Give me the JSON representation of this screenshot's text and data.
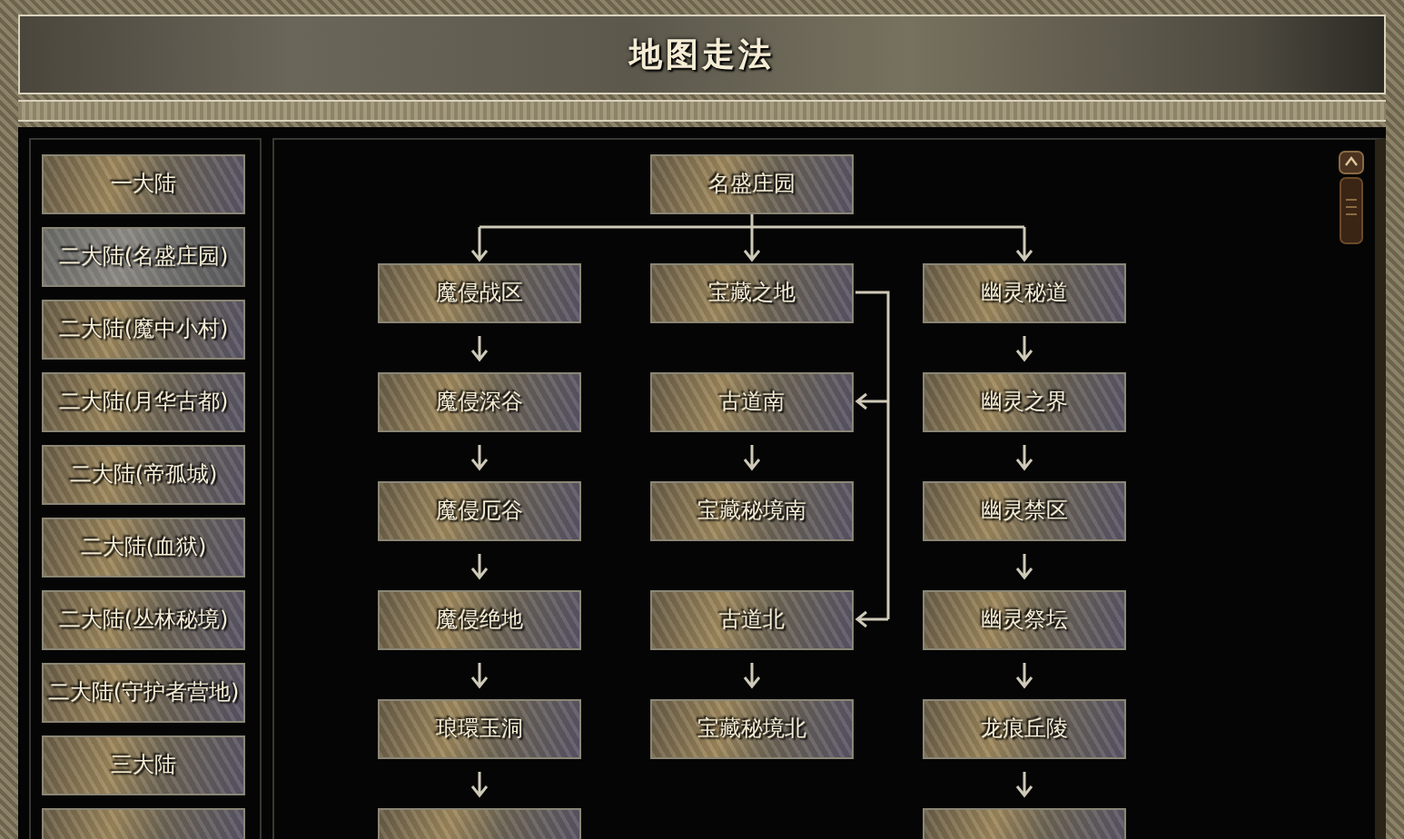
{
  "window": {
    "title": "地图走法"
  },
  "sidebar": {
    "more_below": true,
    "items": [
      {
        "label": "一大陆",
        "selected": false
      },
      {
        "label": "二大陆(名盛庄园)",
        "selected": true
      },
      {
        "label": "二大陆(魔中小村)",
        "selected": false
      },
      {
        "label": "二大陆(月华古都)",
        "selected": false
      },
      {
        "label": "二大陆(帝孤城)",
        "selected": false
      },
      {
        "label": "二大陆(血狱)",
        "selected": false
      },
      {
        "label": "二大陆(丛林秘境)",
        "selected": false
      },
      {
        "label": "二大陆(守护者营地)",
        "selected": false
      },
      {
        "label": "三大陆",
        "selected": false
      }
    ]
  },
  "diagram": {
    "root": "名盛庄园",
    "columns": [
      {
        "continues": true,
        "nodes": [
          {
            "label": "魔侵战区",
            "from_side": false
          },
          {
            "label": "魔侵深谷",
            "from_side": false
          },
          {
            "label": "魔侵厄谷",
            "from_side": false
          },
          {
            "label": "魔侵绝地",
            "from_side": false
          },
          {
            "label": "琅環玉洞",
            "from_side": false
          }
        ]
      },
      {
        "nodes": [
          {
            "label": "宝藏之地",
            "from_side": false
          },
          {
            "label": "古道南",
            "from_side": true
          },
          {
            "label": "宝藏秘境南",
            "from_side": false
          },
          {
            "label": "古道北",
            "from_side": true
          },
          {
            "label": "宝藏秘境北",
            "from_side": false
          }
        ]
      },
      {
        "continues": true,
        "nodes": [
          {
            "label": "幽灵秘道",
            "from_side": false
          },
          {
            "label": "幽灵之界",
            "from_side": false
          },
          {
            "label": "幽灵禁区",
            "from_side": false
          },
          {
            "label": "幽灵祭坛",
            "from_side": false
          },
          {
            "label": "龙痕丘陵",
            "from_side": false
          }
        ]
      }
    ]
  }
}
